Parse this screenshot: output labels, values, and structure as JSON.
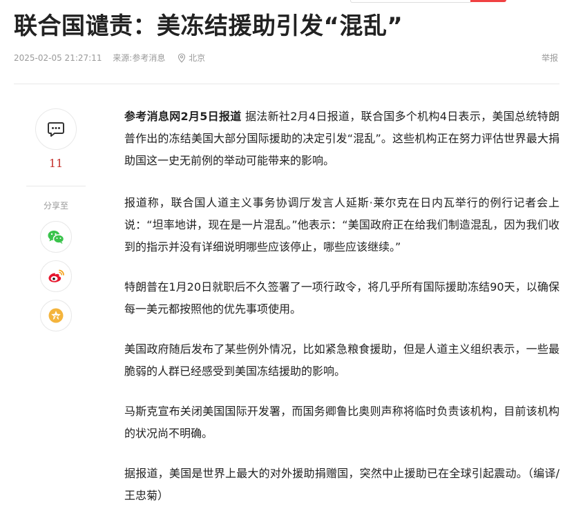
{
  "article": {
    "title": "联合国谴责：美冻结援助引发“混乱”",
    "date": "2025-02-05 21:27:11",
    "source_label": "来源: ",
    "source": "参考消息",
    "location": "北京",
    "report_label": "举报",
    "lead": "参考消息网2月5日报道",
    "paragraphs": [
      " 据法新社2月4日报道，联合国多个机构4日表示，美国总统特朗普作出的冻结美国大部分国际援助的决定引发“混乱”。这些机构正在努力评估世界最大捐助国这一史无前例的举动可能带来的影响。",
      "报道称，联合国人道主义事务协调厅发言人延斯·莱尔克在日内瓦举行的例行记者会上说：“坦率地讲，现在是一片混乱。”他表示：“美国政府正在给我们制造混乱，因为我们收到的指示并没有详细说明哪些应该停止，哪些应该继续。”",
      "特朗普在1月20日就职后不久签署了一项行政令，将几乎所有国际援助冻结90天，以确保每一美元都按照他的优先事项使用。",
      "美国政府随后发布了某些例外情况，比如紧急粮食援助，但是人道主义组织表示，一些最脆弱的人群已经感受到美国冻结援助的影响。",
      "马斯克宣布关闭美国国际开发署，而国务卿鲁比奥则声称将临时负责该机构，目前该机构的状况尚不明确。",
      "据报道，美国是世界上最大的对外援助捐赠国，突然中止援助已在全球引起震动。（编译/王忠菊）"
    ]
  },
  "sidebar": {
    "comment_icon": "comment-icon",
    "comment_count": "11",
    "share_label": "分享至",
    "share_icons": [
      "wechat-icon",
      "weibo-icon",
      "favorite-icon"
    ]
  },
  "colors": {
    "accent": "#f04142",
    "comment_count": "#c4302b",
    "meta_text": "#999999",
    "wechat": "#39c34b",
    "weibo": "#e6162d",
    "favorite": "#f4b43c"
  }
}
